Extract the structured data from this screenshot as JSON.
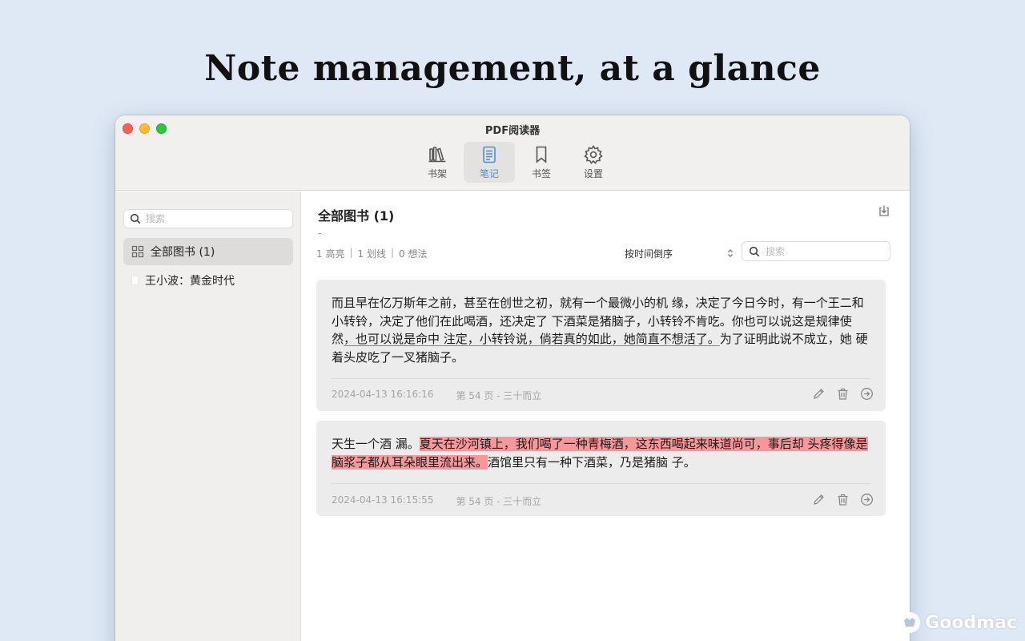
{
  "headline": "Note management, at a glance",
  "window": {
    "title": "PDF阅读器"
  },
  "toolbar": {
    "items": [
      {
        "label": "书架",
        "icon": "bookshelf-icon"
      },
      {
        "label": "笔记",
        "icon": "notes-icon",
        "active": true
      },
      {
        "label": "书签",
        "icon": "bookmark-icon"
      },
      {
        "label": "设置",
        "icon": "gear-icon"
      }
    ]
  },
  "sidebar": {
    "search_placeholder": "搜索",
    "items": [
      {
        "label": "全部图书 (1)",
        "icon": "grid-icon",
        "selected": true
      },
      {
        "label": "王小波：黄金时代",
        "icon": "document-icon"
      }
    ]
  },
  "main": {
    "title": "全部图书 (1)",
    "dash": "-",
    "stats": {
      "highlights": "1 高亮",
      "underlines": "1 划线",
      "thoughts": "0 想法"
    },
    "sort_label": "按时间倒序",
    "search_placeholder": "搜索",
    "notes": [
      {
        "text_before": "而且早在亿万斯年之前，甚至在创世之初，就有一个最微小的机 缘，决定了今日今时，有一个王二和小转铃，决定了他们在此喝酒，还决定了 下酒菜是猪脑子，小转铃不肯吃。你也可以说这是规律使然",
        "text_marked": "，也可以说是命中 注定，小转铃说，倘若真的如此，她简直不想活了。",
        "text_after": "为了证明此说不成立，她 硬着头皮吃了一叉猪脑子。",
        "mark_style": "underline",
        "timestamp": "2024-04-13 16:16:16",
        "location": "第 54 页 - 三十而立"
      },
      {
        "text_before": "天生一个酒 漏。",
        "text_marked": "夏天在沙河镇上，我们喝了一种青梅酒，这东西喝起来味道尚可，事后却 头疼得像是脑浆子都从耳朵眼里流出来。",
        "text_after": "酒馆里只有一种下酒菜，乃是猪脑 子。",
        "mark_style": "highlight",
        "timestamp": "2024-04-13 16:15:55",
        "location": "第 54 页 - 三十而立"
      }
    ]
  },
  "watermark": "Goodmac",
  "colors": {
    "background": "#dfe9f6",
    "accent": "#4a8fd8",
    "highlight": "#f5989c",
    "underline": "#e8585e"
  }
}
